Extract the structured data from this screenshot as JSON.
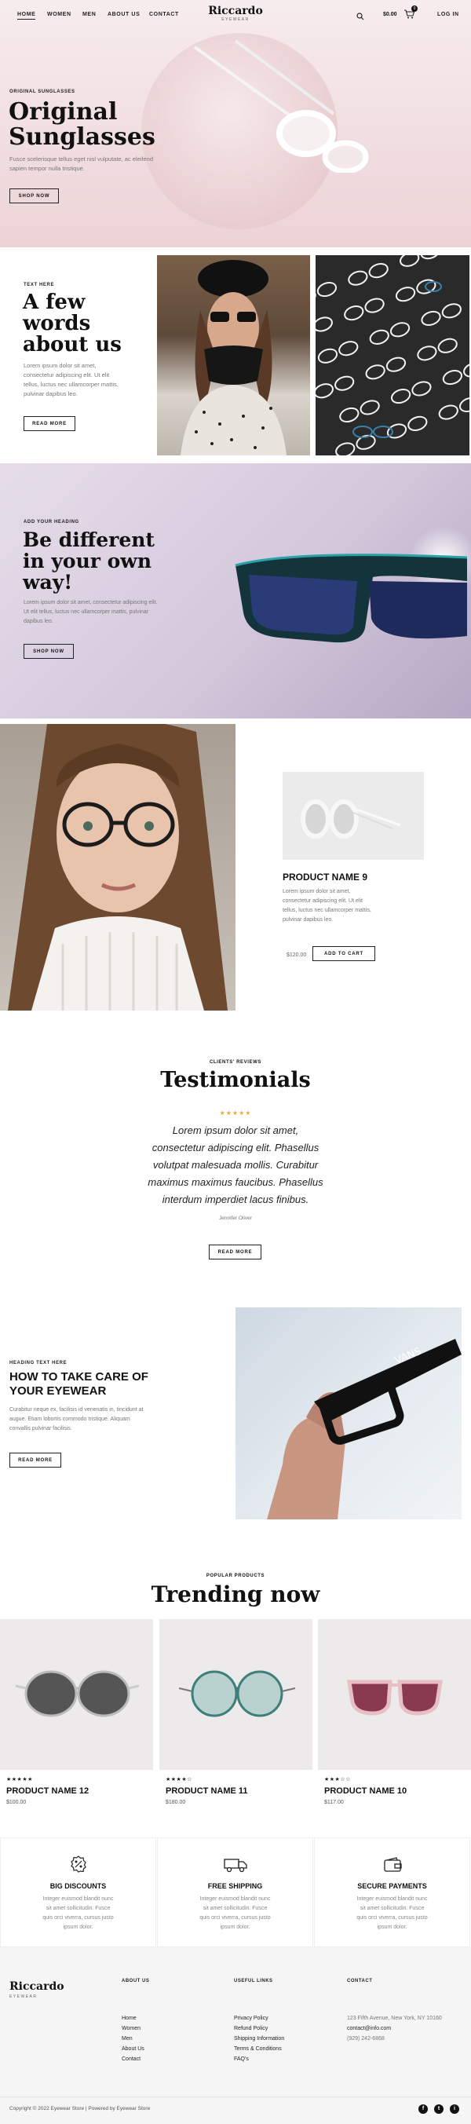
{
  "nav": {
    "links": [
      "HOME",
      "WOMEN",
      "MEN",
      "ABOUT US",
      "CONTACT"
    ],
    "logo": "Riccardo",
    "logo_sub": "EYEWEAR",
    "cart_total": "$0.00",
    "cart_count": "0",
    "login": "LOG IN"
  },
  "hero": {
    "eyebrow": "ORIGINAL SUNGLASSES",
    "title_l1": "Original",
    "title_l2": "Sunglasses",
    "text_l1": "Fusce scelerisque tellus eget nisl vulputate, ac eleifend",
    "text_l2": "sapien tempor nulla tristique.",
    "button": "SHOP NOW"
  },
  "about": {
    "eyebrow": "TEXT HERE",
    "title_l1": "A few",
    "title_l2": "words",
    "title_l3": "about us",
    "text": [
      "Lorem ipsum dolor sit amet,",
      "consectetur adipiscing elit. Ut elit",
      "tellus, luctus nec ullamcorper mattis,",
      "pulvinar dapibus leo."
    ],
    "button": "READ MORE"
  },
  "different": {
    "eyebrow": "ADD YOUR HEADING",
    "title_l1": "Be different",
    "title_l2": "in your own",
    "title_l3": "way!",
    "text": [
      "Lorem ipsum dolor sit amet, consectetur adipiscing elit.",
      "Ut elit tellus, luctus nec ullamcorper mattis, pulvinar",
      "dapibus leo."
    ],
    "button": "SHOP NOW"
  },
  "product9": {
    "name": "PRODUCT NAME 9",
    "text": [
      "Lorem ipsum dolor sit amet,",
      "consectetur adipiscing elit. Ut elit",
      "tellus, luctus nec ullamcorper mattis,",
      "pulvinar dapibus leo."
    ],
    "price": "$120.00",
    "button": "ADD TO CART"
  },
  "testimonials": {
    "eyebrow": "CLIENTS' REVIEWS",
    "title": "Testimonials",
    "stars": "★★★★★",
    "quote": [
      "Lorem ipsum dolor sit amet,",
      "consectetur adipiscing elit. Phasellus",
      "volutpat malesuada mollis. Curabitur",
      "maximus maximus faucibus. Phasellus",
      "interdum imperdiet lacus finibus."
    ],
    "author": "Jennifer Oliver",
    "button": "READ MORE"
  },
  "care": {
    "eyebrow": "HEADING TEXT HERE",
    "title_l1": "HOW TO TAKE CARE OF",
    "title_l2": "YOUR EYEWEAR",
    "text": [
      "Curabitur neque ex, facilisis id venenatis in, tincidunt at",
      "augue. Etiam lobortis commodo tristique. Aliquam",
      "convallis pulvinar facilisis."
    ],
    "button": "READ MORE"
  },
  "trending": {
    "eyebrow": "POPULAR PRODUCTS",
    "title": "Trending now",
    "products": [
      {
        "stars": "★★★★★",
        "name": "PRODUCT NAME 12",
        "price": "$100.00"
      },
      {
        "stars": "★★★★☆",
        "name": "PRODUCT NAME 11",
        "price": "$180.00"
      },
      {
        "stars": "★★★☆☆",
        "name": "PRODUCT NAME 10",
        "price": "$117.00"
      }
    ]
  },
  "features": [
    {
      "title": "BIG DISCOUNTS",
      "text": [
        "Integer euismod blandit nunc",
        "sit amet sollicitudin. Fusce",
        "quis orci viverra, cursus justo",
        "ipsum dolor."
      ]
    },
    {
      "title": "FREE SHIPPING",
      "text": [
        "Integer euismod blandit nunc",
        "sit amet sollicitudin. Fusce",
        "quis orci viverra, cursus justo",
        "ipsum dolor."
      ]
    },
    {
      "title": "SECURE PAYMENTS",
      "text": [
        "Integer euismod blandit nunc",
        "sit amet sollicitudin. Fusce",
        "quis orci viverra, cursus justo",
        "ipsum dolor."
      ]
    }
  ],
  "footer": {
    "logo": "Riccardo",
    "logo_sub": "EYEWEAR",
    "about_head": "ABOUT US",
    "about_links": [
      "Home",
      "Women",
      "Men",
      "About Us",
      "Contact"
    ],
    "useful_head": "USEFUL LINKS",
    "useful_links": [
      "Privacy Policy",
      "Refund Policy",
      "Shipping Information",
      "Terms & Conditions",
      "FAQ's"
    ],
    "contact_head": "CONTACT",
    "address": "123 Fifth Avenue, New York, NY 10160",
    "email": "contact@info.com",
    "phone": "(929) 242-6868",
    "copyright": "Copyright © 2022 Eyewear Store | Powered by Eyewear Store",
    "social": [
      "f",
      "t",
      "i"
    ]
  }
}
